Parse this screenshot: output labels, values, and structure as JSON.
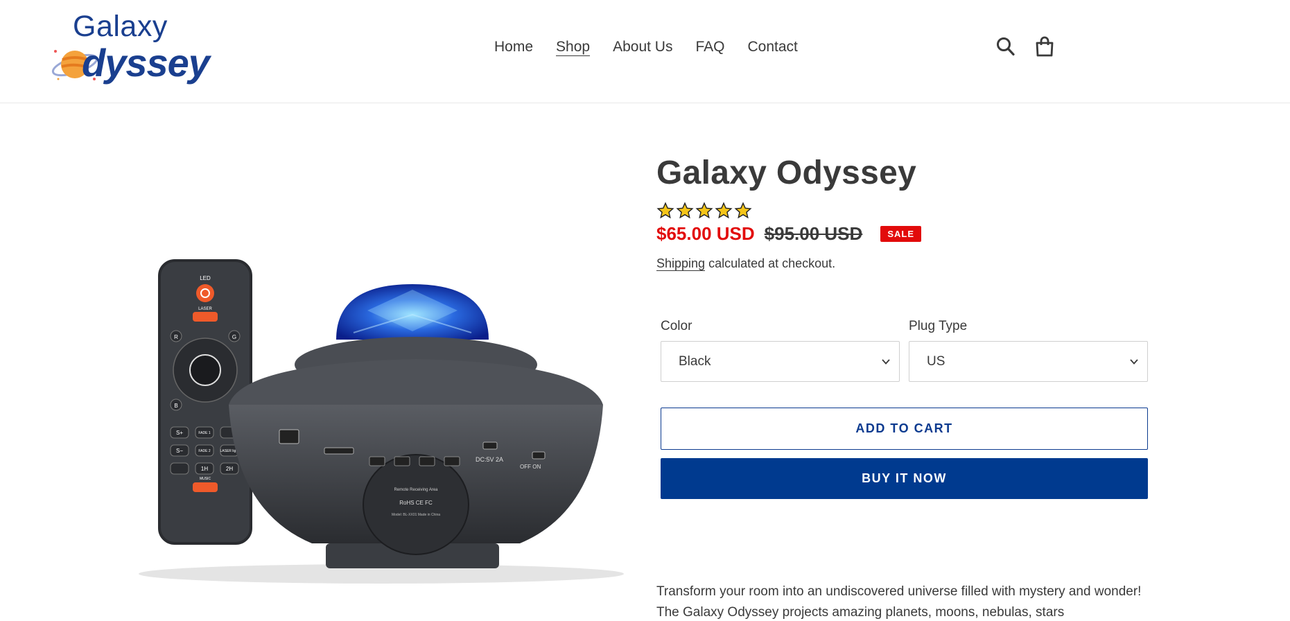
{
  "brand": {
    "logo_top": "Galaxy",
    "logo_bottom": "dyssey"
  },
  "nav": {
    "items": [
      {
        "label": "Home",
        "active": false
      },
      {
        "label": "Shop",
        "active": true
      },
      {
        "label": "About Us",
        "active": false
      },
      {
        "label": "FAQ",
        "active": false
      },
      {
        "label": "Contact",
        "active": false
      }
    ]
  },
  "header_icons": [
    "search-icon",
    "cart-icon"
  ],
  "product": {
    "title": "Galaxy Odyssey",
    "rating": 5,
    "rating_max": 5,
    "price_sale": "$65.00 USD",
    "price_regular": "$95.00 USD",
    "sale_badge": "SALE",
    "shipping_link": "Shipping",
    "shipping_text": " calculated at checkout.",
    "options": {
      "color": {
        "label": "Color",
        "value": "Black"
      },
      "plug": {
        "label": "Plug Type",
        "value": "US"
      }
    },
    "add_to_cart": "ADD TO CART",
    "buy_now": "BUY IT NOW",
    "description": "Transform your room into an undiscovered universe filled with mystery and wonder!  The Galaxy Odyssey projects amazing planets, moons, nebulas, stars"
  },
  "image_labels": {
    "remote_top": "LED",
    "remote_laser": "LASER",
    "remote_music": "MUSIC",
    "dc_label": "DC:5V 2A",
    "switch_label": "OFF ON",
    "receiving_area": "Remote Receiving Area",
    "certs": "RoHS CE FC",
    "model": "Model: BL-XX01    Made in China",
    "remote_r": "R",
    "remote_g": "G",
    "remote_b": "B",
    "remote_s_plus": "S+",
    "remote_s_minus": "S−",
    "remote_fade1": "FADE 1",
    "remote_fade2": "FADE 2",
    "remote_laser_light": "LASER light",
    "remote_1h": "1H",
    "remote_2h": "2H"
  },
  "colors": {
    "brand_blue": "#003a8f",
    "sale_red": "#e20b0b",
    "text": "#3a3a3a",
    "star_fill": "#f5c518"
  }
}
